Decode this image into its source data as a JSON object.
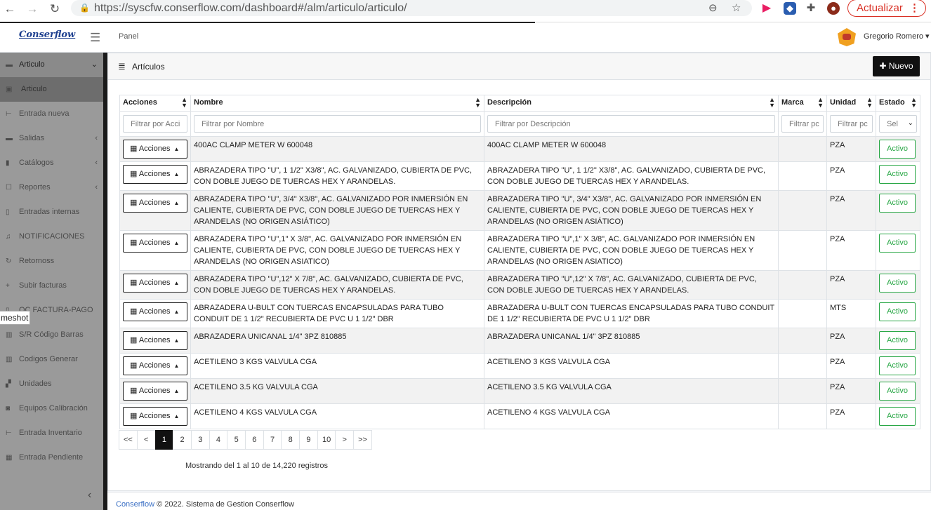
{
  "browser": {
    "url": "https://syscfw.conserflow.com/dashboard#/alm/articulo/articulo/",
    "update_label": "Actualizar"
  },
  "header": {
    "logo": "Conserflow",
    "panel_link": "Panel",
    "user_name": "Gregorio Romero"
  },
  "sidebar": {
    "tooltip": "meshot",
    "items": [
      {
        "label": "Articulo",
        "icon": "folder-icon",
        "chev": "⌄"
      },
      {
        "label": "Articulo",
        "icon": "box-icon",
        "chev": ""
      },
      {
        "label": "Entrada nueva",
        "icon": "import-icon",
        "chev": ""
      },
      {
        "label": "Salidas",
        "icon": "folder-icon",
        "chev": "‹"
      },
      {
        "label": "Catálogos",
        "icon": "bookmark-icon",
        "chev": "‹"
      },
      {
        "label": "Reportes",
        "icon": "edit-icon",
        "chev": "‹"
      },
      {
        "label": "Entradas internas",
        "icon": "file-icon",
        "chev": ""
      },
      {
        "label": "NOTIFICACIONES",
        "icon": "bell-icon",
        "chev": ""
      },
      {
        "label": "Retornoss",
        "icon": "refresh-icon",
        "chev": ""
      },
      {
        "label": "Subir facturas",
        "icon": "plus-icon",
        "chev": ""
      },
      {
        "label": "OC FACTURA-PAGO",
        "icon": "file-icon",
        "chev": ""
      },
      {
        "label": "S/R Código Barras",
        "icon": "barcode-icon",
        "chev": ""
      },
      {
        "label": "Codigos Generar",
        "icon": "barcode-icon",
        "chev": ""
      },
      {
        "label": "Unidades",
        "icon": "cubes-icon",
        "chev": ""
      },
      {
        "label": "Equipos Calibración",
        "icon": "camera-icon",
        "chev": ""
      },
      {
        "label": "Entrada Inventario",
        "icon": "import-icon",
        "chev": ""
      },
      {
        "label": "Entrada Pendiente",
        "icon": "building-icon",
        "chev": ""
      }
    ]
  },
  "card": {
    "title": "Artículos",
    "new_button": "Nuevo"
  },
  "table": {
    "columns": [
      "Acciones",
      "Nombre",
      "Descripción",
      "Marca",
      "Unidad",
      "Estado"
    ],
    "filters": [
      "Filtrar por Acci",
      "Filtrar por Nombre",
      "Filtrar por Descripción",
      "Filtrar pc",
      "Filtrar pc",
      "Sel"
    ],
    "action_label": "Acciones",
    "rows": [
      {
        "nombre": "400AC CLAMP METER W 600048",
        "descripcion": "400AC CLAMP METER W 600048",
        "marca": "",
        "unidad": "PZA",
        "estado": "Activo"
      },
      {
        "nombre": "ABRAZADERA TIPO \"U\", 1 1/2\" X3/8\", AC. GALVANIZADO, CUBIERTA DE PVC, CON DOBLE JUEGO DE TUERCAS HEX Y ARANDELAS.",
        "descripcion": "ABRAZADERA TIPO \"U\", 1 1/2\" X3/8\", AC. GALVANIZADO, CUBIERTA DE PVC, CON DOBLE JUEGO DE TUERCAS HEX Y ARANDELAS.",
        "marca": "",
        "unidad": "PZA",
        "estado": "Activo"
      },
      {
        "nombre": "ABRAZADERA TIPO \"U\", 3/4\" X3/8\", AC. GALVANIZADO POR INMERSIÓN EN CALIENTE, CUBIERTA DE PVC, CON DOBLE JUEGO DE TUERCAS HEX Y ARANDELAS (NO ORIGEN ASIÁTICO)",
        "descripcion": "ABRAZADERA TIPO \"U\", 3/4\" X3/8\", AC. GALVANIZADO POR INMERSIÓN EN CALIENTE, CUBIERTA DE PVC, CON DOBLE JUEGO DE TUERCAS HEX Y ARANDELAS (NO ORIGEN ASIÁTICO)",
        "marca": "",
        "unidad": "PZA",
        "estado": "Activo"
      },
      {
        "nombre": "ABRAZADERA TIPO \"U\",1\" X 3/8\", AC. GALVANIZADO POR INMERSIÓN EN CALIENTE, CUBIERTA DE PVC, CON DOBLE JUEGO DE TUERCAS HEX Y ARANDELAS (NO ORIGEN ASIATICO)",
        "descripcion": "ABRAZADERA TIPO \"U\",1\" X 3/8\", AC. GALVANIZADO POR INMERSIÓN EN CALIENTE, CUBIERTA DE PVC, CON DOBLE JUEGO DE TUERCAS HEX Y ARANDELAS (NO ORIGEN ASIATICO)",
        "marca": "",
        "unidad": "PZA",
        "estado": "Activo"
      },
      {
        "nombre": "ABRAZADERA TIPO \"U\",12\" X 7/8\", AC. GALVANIZADO, CUBIERTA DE PVC, CON DOBLE JUEGO DE TUERCAS HEX Y ARANDELAS.",
        "descripcion": "ABRAZADERA TIPO \"U\",12\" X 7/8\", AC. GALVANIZADO, CUBIERTA DE PVC, CON DOBLE JUEGO DE TUERCAS HEX Y ARANDELAS.",
        "marca": "",
        "unidad": "PZA",
        "estado": "Activo"
      },
      {
        "nombre": "ABRAZADERA U-BULT CON TUERCAS ENCAPSULADAS PARA TUBO CONDUIT DE 1 1/2\" RECUBIERTA DE PVC U 1 1/2\" DBR",
        "descripcion": "ABRAZADERA U-BULT CON TUERCAS ENCAPSULADAS PARA TUBO CONDUIT DE 1 1/2\" RECUBIERTA DE PVC U 1 1/2\" DBR",
        "marca": "",
        "unidad": "MTS",
        "estado": "Activo"
      },
      {
        "nombre": "ABRAZADERA UNICANAL 1/4\" 3PZ 810885",
        "descripcion": "ABRAZADERA UNICANAL 1/4\" 3PZ 810885",
        "marca": "",
        "unidad": "PZA",
        "estado": "Activo"
      },
      {
        "nombre": "ACETILENO 3 KGS VALVULA CGA",
        "descripcion": "ACETILENO 3 KGS VALVULA CGA",
        "marca": "",
        "unidad": "PZA",
        "estado": "Activo"
      },
      {
        "nombre": "ACETILENO 3.5 KG VALVULA CGA",
        "descripcion": "ACETILENO 3.5 KG VALVULA CGA",
        "marca": "",
        "unidad": "PZA",
        "estado": "Activo"
      },
      {
        "nombre": "ACETILENO 4 KGS VALVULA CGA",
        "descripcion": "ACETILENO 4 KGS VALVULA CGA",
        "marca": "",
        "unidad": "PZA",
        "estado": "Activo"
      }
    ]
  },
  "pagination": {
    "pages": [
      "<<",
      "<",
      "1",
      "2",
      "3",
      "4",
      "5",
      "6",
      "7",
      "8",
      "9",
      "10",
      ">",
      ">>"
    ],
    "active": "1",
    "info": "Mostrando del 1 al 10 de 14,220 registros"
  },
  "footer": {
    "brand": "Conserflow",
    "text": " © 2022. Sistema de Gestion Conserflow"
  },
  "colors": {
    "sidebar_bg": "#9a9a9a",
    "active_badge": "#28a745",
    "primary_dark": "#111111",
    "update_red": "#d93025"
  }
}
